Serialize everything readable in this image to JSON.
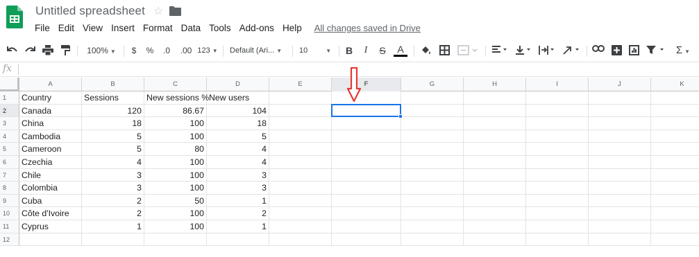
{
  "document": {
    "title": "Untitled spreadsheet",
    "saved_status": "All changes saved in Drive"
  },
  "menu": [
    "File",
    "Edit",
    "View",
    "Insert",
    "Format",
    "Data",
    "Tools",
    "Add-ons",
    "Help"
  ],
  "toolbar": {
    "zoom": "100%",
    "currency": "$",
    "percent": "%",
    "decrease_decimals": ".0",
    "increase_decimals": ".00",
    "more_formats": "123",
    "font_family": "Default (Ari...",
    "font_size": "10",
    "bold": "B",
    "italic": "I",
    "strikethrough": "S",
    "text_color": "A",
    "functions": "Σ"
  },
  "formula_bar": {
    "fx": "fx",
    "value": ""
  },
  "sheet": {
    "columns": [
      "A",
      "B",
      "C",
      "D",
      "E",
      "F",
      "G",
      "H",
      "I",
      "J",
      "K"
    ],
    "rows": [
      "1",
      "2",
      "3",
      "4",
      "5",
      "6",
      "7",
      "8",
      "9",
      "10",
      "11",
      "12"
    ],
    "header": [
      "Country",
      "Sessions",
      "New sessions %",
      "New users"
    ],
    "data": [
      [
        "Canada",
        "120",
        "86.67",
        "104"
      ],
      [
        "China",
        "18",
        "100",
        "18"
      ],
      [
        "Cambodia",
        "5",
        "100",
        "5"
      ],
      [
        "Cameroon",
        "5",
        "80",
        "4"
      ],
      [
        "Czechia",
        "4",
        "100",
        "4"
      ],
      [
        "Chile",
        "3",
        "100",
        "3"
      ],
      [
        "Colombia",
        "3",
        "100",
        "3"
      ],
      [
        "Cuba",
        "2",
        "50",
        "1"
      ],
      [
        "Côte d'Ivoire",
        "2",
        "100",
        "2"
      ],
      [
        "Cyprus",
        "1",
        "100",
        "1"
      ]
    ],
    "selected_cell": "F2"
  },
  "colors": {
    "brand_green": "#0f9d58",
    "selection_blue": "#1a73e8",
    "annotation_red": "#e53935"
  }
}
